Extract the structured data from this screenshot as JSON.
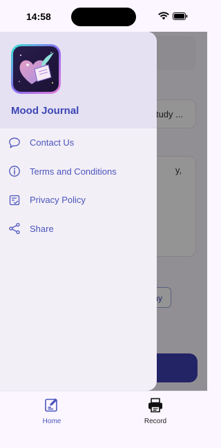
{
  "status_bar": {
    "time": "14:58"
  },
  "background": {
    "search_snippet": "tudy ...",
    "textarea_snippet": "y,",
    "chip_snippet": "ay"
  },
  "drawer": {
    "app_name": "Mood Journal",
    "items": [
      {
        "label": "Contact Us",
        "icon": "chat-bubble-icon"
      },
      {
        "label": "Terms and Conditions",
        "icon": "info-icon"
      },
      {
        "label": "Privacy Policy",
        "icon": "policy-document-icon"
      },
      {
        "label": "Share",
        "icon": "share-icon"
      }
    ]
  },
  "tabbar": {
    "tabs": [
      {
        "label": "Home",
        "icon": "journal-edit-icon",
        "active": true
      },
      {
        "label": "Record",
        "icon": "printer-icon",
        "active": false
      }
    ]
  },
  "colors": {
    "accent": "#4b55bb",
    "app_name": "#3c46b5",
    "drawer_bg": "#f3eff7",
    "drawer_header_bg": "#e5e1f2",
    "primary_button": "#3c3fb0"
  }
}
